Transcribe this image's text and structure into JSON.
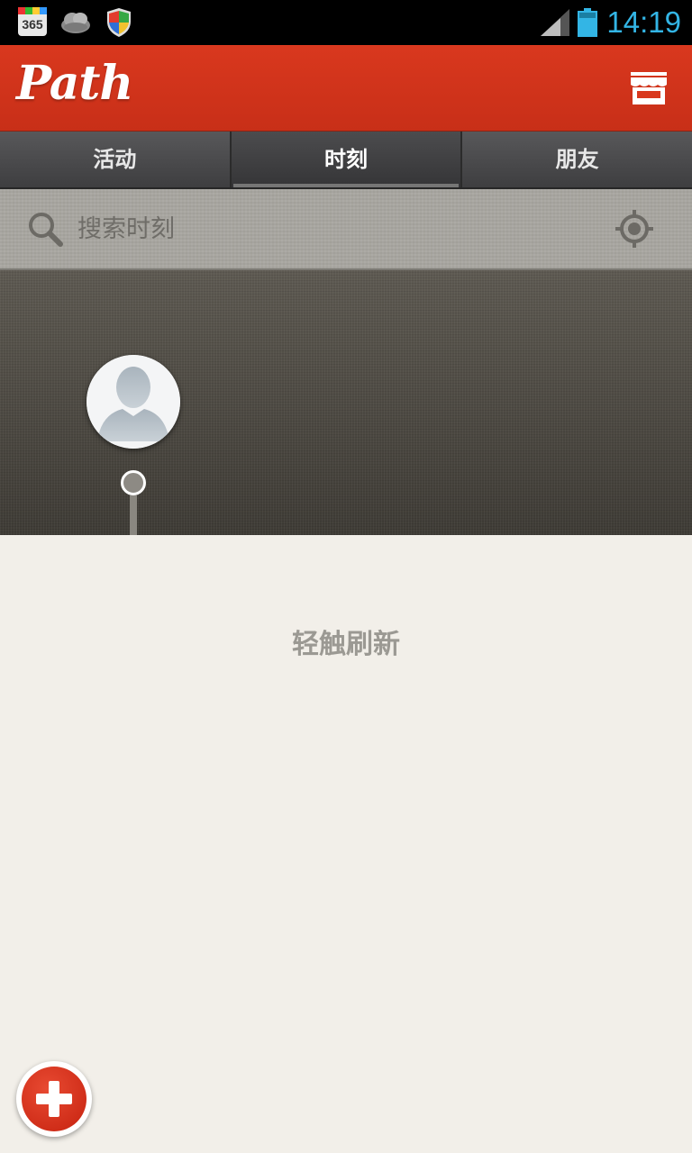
{
  "status_bar": {
    "time": "14:19",
    "calendar_badge": "365",
    "icons": [
      "calendar-365-icon",
      "cloud-icon",
      "shield-icon",
      "signal-icon",
      "battery-icon"
    ]
  },
  "app_bar": {
    "logo": "Path",
    "store_icon": "store-icon"
  },
  "tabs": [
    {
      "label": "活动",
      "active": false
    },
    {
      "label": "时刻",
      "active": true
    },
    {
      "label": "朋友",
      "active": false
    }
  ],
  "search": {
    "placeholder": "搜索时刻",
    "icon": "search-icon",
    "location_icon": "locate-icon"
  },
  "main": {
    "refresh_text": "轻触刷新"
  },
  "fab": {
    "icon": "plus-icon"
  },
  "colors": {
    "brand_red": "#d9381e",
    "clock_blue": "#33b5e5",
    "background": "#f2efe9"
  }
}
